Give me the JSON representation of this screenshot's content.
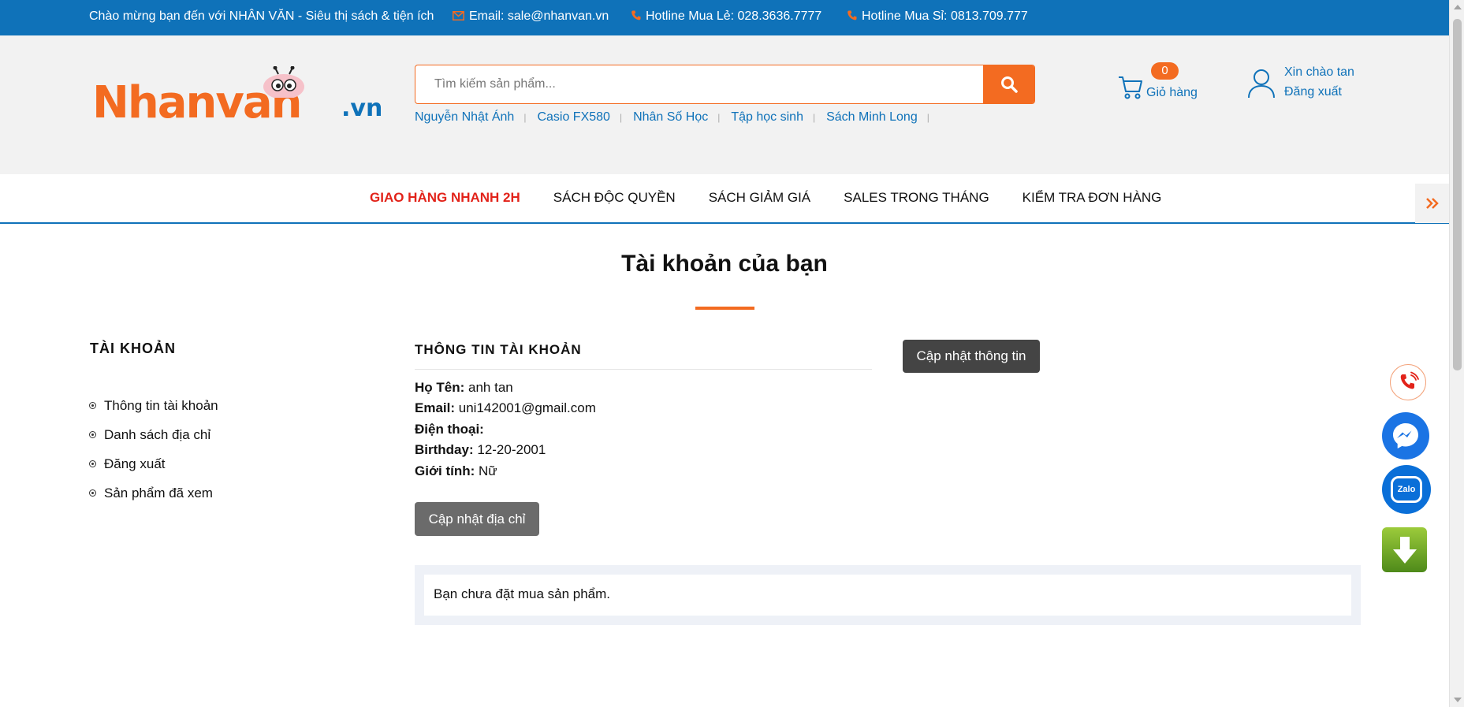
{
  "topbar": {
    "welcome": "Chào mừng bạn đến với NHÂN VĂN - Siêu thị sách & tiện ích",
    "email": "Email: sale@nhanvan.vn",
    "hotline_retail": "Hotline Mua Lẻ: 028.3636.7777",
    "hotline_wholesale": "Hotline Mua Sỉ: 0813.709.777"
  },
  "header": {
    "logo_text": "Nhanvan",
    "logo_suffix": ".vn",
    "search_placeholder": "Tìm kiếm sản phẩm...",
    "keywords": [
      "Nguyễn Nhật Ánh",
      "Casio FX580",
      "Nhân Số Học",
      "Tập học sinh",
      "Sách Minh Long"
    ],
    "cart_count": "0",
    "cart_label": "Giỏ hàng",
    "greeting": "Xin chào tan",
    "logout": "Đăng xuất"
  },
  "nav": {
    "items": [
      "GIAO HÀNG NHANH 2H",
      "SÁCH ĐỘC QUYỀN",
      "SÁCH GIẢM GIÁ",
      "SALES TRONG THÁNG",
      "KIỂM TRA ĐƠN HÀNG"
    ]
  },
  "page": {
    "title": "Tài khoản của bạn"
  },
  "sidebar": {
    "title": "TÀI KHOẢN",
    "items": [
      "Thông tin tài khoản",
      "Danh sách địa chỉ",
      "Đăng xuất",
      "Sản phẩm đã xem"
    ]
  },
  "account_info": {
    "title": "THÔNG TIN TÀI KHOẢN",
    "update_info_button": "Cập nhật thông tin",
    "update_address_button": "Cập nhật địa chỉ",
    "fields": [
      {
        "label": "Họ Tên:",
        "value": "anh tan"
      },
      {
        "label": "Email:",
        "value": "uni142001@gmail.com"
      },
      {
        "label": "Điện thoại:",
        "value": ""
      },
      {
        "label": "Birthday:",
        "value": "12-20-2001"
      },
      {
        "label": "Giới tính:",
        "value": "Nữ"
      }
    ],
    "orders_empty": "Bạn chưa đặt mua sản phẩm."
  },
  "floating": {
    "zalo_label": "Zalo"
  },
  "colors": {
    "brand_blue": "#0f72b9",
    "brand_orange": "#f36b21",
    "hot_red": "#e2231a"
  }
}
